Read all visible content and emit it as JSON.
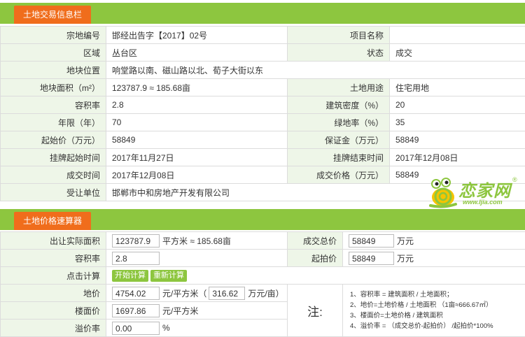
{
  "info": {
    "title": "土地交易信息栏",
    "rows": [
      [
        "宗地编号",
        "邯经出告字【2017】02号",
        "项目名称",
        ""
      ],
      [
        "区域",
        "丛台区",
        "状态",
        "成交"
      ],
      [
        "地块位置",
        "响堂路以南、磁山路以北、荀子大街以东"
      ],
      [
        "地块面积（m²）",
        "123787.9 ≈ 185.68亩",
        "土地用途",
        "住宅用地"
      ],
      [
        "容积率",
        "2.8",
        "建筑密度（%）",
        "20"
      ],
      [
        "年限（年）",
        "70",
        "绿地率（%）",
        "35"
      ],
      [
        "起始价（万元）",
        "58849",
        "保证金（万元）",
        "58849"
      ],
      [
        "挂牌起始时间",
        "2017年11月27日",
        "挂牌结束时间",
        "2017年12月08日"
      ],
      [
        "成交时间",
        "2017年12月08日",
        "成交价格（万元）",
        "58849"
      ],
      [
        "受让单位",
        "邯郸市中和房地产开发有限公司"
      ]
    ]
  },
  "logo": {
    "brand": "恋家网",
    "url": "www.ljia.com",
    "reg": "®"
  },
  "calc": {
    "title": "土地价格速算器",
    "area_label": "出让实际面积",
    "area_value": "123787.9",
    "area_unit": "平方米 ≈ 185.68亩",
    "total_label": "成交总价",
    "total_value": "58849",
    "total_unit": "万元",
    "ratio_label": "容积率",
    "ratio_value": "2.8",
    "start_label": "起拍价",
    "start_value": "58849",
    "start_unit": "万元",
    "click_label": "点击计算",
    "btn_start": "开始计算",
    "btn_reset": "重新计算",
    "land_price_label": "地价",
    "land_price_value": "4754.02",
    "land_price_unit1": "元/平方米（",
    "land_price_mu": "316.62",
    "land_price_unit2": "万元/亩）",
    "floor_price_label": "楼面价",
    "floor_price_value": "1697.86",
    "floor_price_unit": "元/平方米",
    "premium_label": "溢价率",
    "premium_value": "0.00",
    "premium_unit": "%",
    "note_label": "注:",
    "notes": [
      "1、容积率 = 建筑面积 / 土地面积；",
      "2、地价=土地价格 / 土地面积 （1亩≈666.67㎡）",
      "3、楼面价=土地价格 / 建筑面积",
      "4、溢价率 = （成交总价-起拍价） /起拍价*100%"
    ]
  }
}
